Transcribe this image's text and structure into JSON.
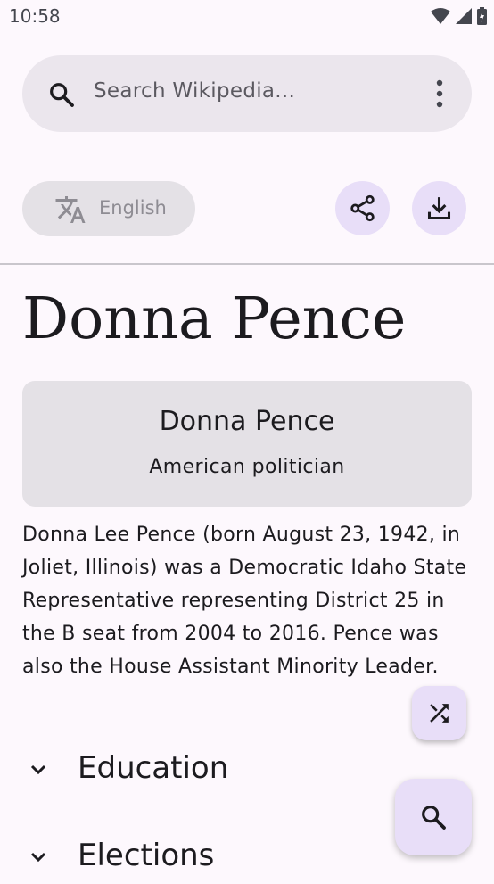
{
  "status": {
    "time": "10:58"
  },
  "search": {
    "placeholder": "Search Wikipedia..."
  },
  "language": {
    "label": "English"
  },
  "article": {
    "title": "Donna Pence",
    "infobox": {
      "title": "Donna Pence",
      "subtitle": "American politician"
    },
    "summary": "Donna Lee Pence (born August 23, 1942, in Joliet, Illinois) was a Democratic Idaho State Representative representing District 25 in the B seat from 2004 to 2016. Pence was also the House Assistant Minority Leader.",
    "sections": [
      "Education",
      "Elections"
    ]
  },
  "icons": {
    "search": "search-icon",
    "overflow": "more-vert-icon",
    "language": "translate-icon",
    "share": "share-icon",
    "download": "download-icon",
    "random": "shuffle-icon",
    "chevron": "chevron-down-icon"
  },
  "colors": {
    "background": "#fdf8fd",
    "search_bar": "#ebe6ed",
    "accent_container": "#e8def8",
    "chip": "#e4e1e6"
  }
}
